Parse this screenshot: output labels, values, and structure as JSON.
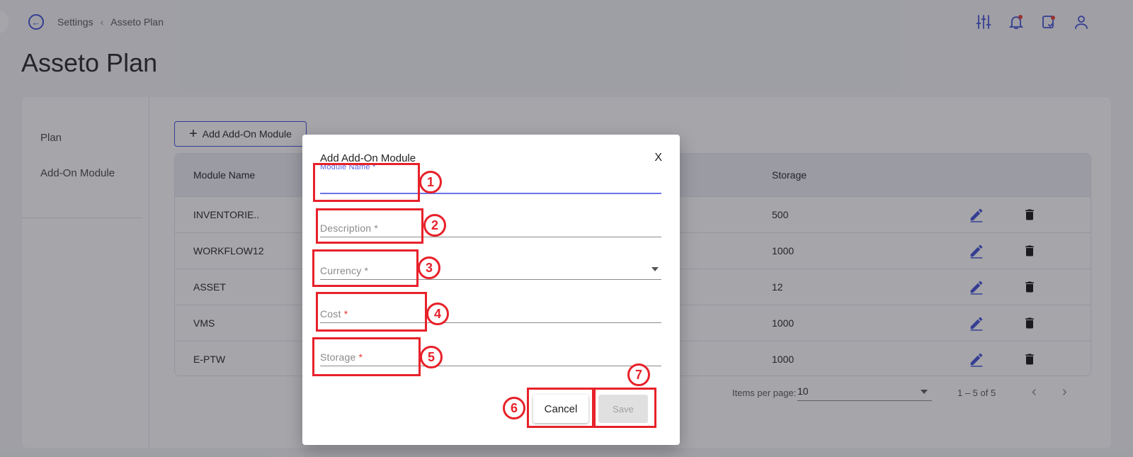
{
  "breadcrumb": {
    "parent": "Settings",
    "current": "Asseto Plan"
  },
  "page_title": "Asseto Plan",
  "sidebar": {
    "items": [
      {
        "label": "Plan"
      },
      {
        "label": "Add-On Module"
      }
    ]
  },
  "toolbar": {
    "add_label": "Add Add-On Module"
  },
  "table": {
    "columns": {
      "module_name": "Module Name",
      "storage": "Storage"
    },
    "rows": [
      {
        "module_name": "INVENTORIE..",
        "storage": "500"
      },
      {
        "module_name": "WORKFLOW12",
        "storage": "1000"
      },
      {
        "module_name": "ASSET",
        "storage": "12"
      },
      {
        "module_name": "VMS",
        "storage": "1000"
      },
      {
        "module_name": "E-PTW",
        "storage": "1000"
      }
    ]
  },
  "pagination": {
    "items_per_page_label": "Items per page:",
    "items_per_page": "10",
    "range": "1 – 5 of 5"
  },
  "dialog": {
    "title": "Add Add-On Module",
    "close": "X",
    "fields": {
      "module_name": "Module Name",
      "description": "Description",
      "currency": "Currency",
      "cost": "Cost",
      "storage": "Storage"
    },
    "required_mark": "*",
    "cancel_label": "Cancel",
    "save_label": "Save"
  },
  "annotations": [
    "1",
    "2",
    "3",
    "4",
    "5",
    "6",
    "7"
  ],
  "colors": {
    "accent": "#3f4fd6",
    "annotation": "#e8212a",
    "required": "#e53935",
    "focus": "#5866e8"
  },
  "icons": [
    "back-arrow-icon",
    "filter-sliders-icon",
    "notification-bell-icon",
    "task-clipboard-icon",
    "user-icon",
    "edit-pencil-icon",
    "delete-trash-icon",
    "chevron-left-icon",
    "chevron-right-icon"
  ]
}
